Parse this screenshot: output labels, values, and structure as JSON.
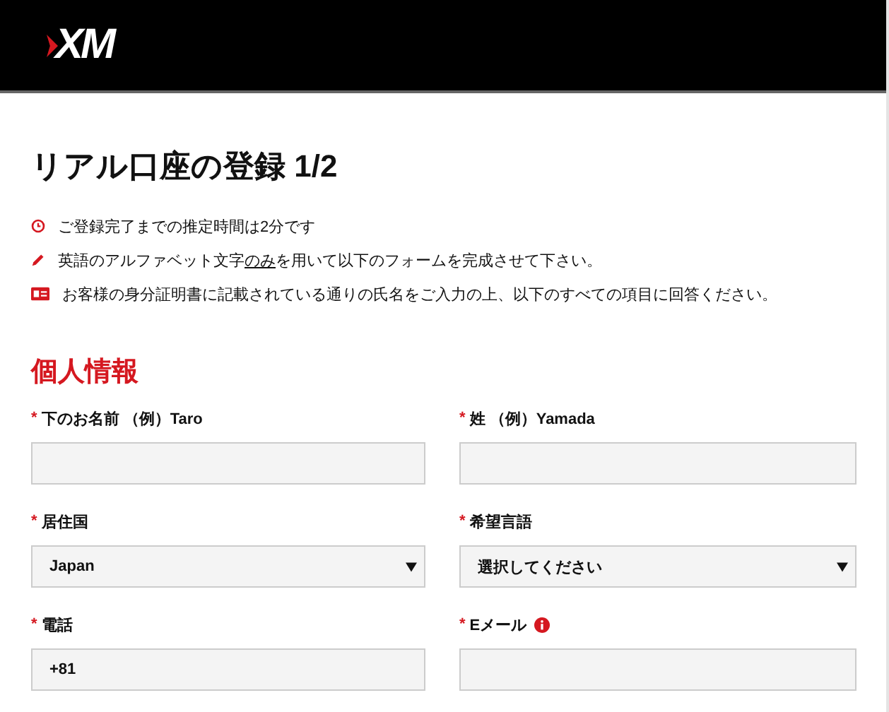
{
  "header": {
    "logo": "XM"
  },
  "title": "リアル口座の登録 1/2",
  "notes": [
    {
      "segments": [
        {
          "text": "ご登録完了までの推定時間は2分です",
          "underlined": false
        }
      ]
    },
    {
      "segments": [
        {
          "text": "英語のアルファベット文字",
          "underlined": false
        },
        {
          "text": "のみ",
          "underlined": true
        },
        {
          "text": "を用いて以下のフォームを完成させて下さい。",
          "underlined": false
        }
      ]
    },
    {
      "segments": [
        {
          "text": "お客様の身分証明書に記載されている通りの氏名をご入力の上、以下のすべての項目に回答ください。",
          "underlined": false
        }
      ]
    }
  ],
  "section": {
    "heading": "個人情報",
    "fields": [
      {
        "kind": "text",
        "marker": "*",
        "label": "下のお名前 （例）Taro",
        "has_info": false
      },
      {
        "kind": "text",
        "marker": "*",
        "label": "姓 （例）Yamada",
        "has_info": false
      },
      {
        "kind": "select",
        "marker": "*",
        "label": "居住国",
        "value": "Japan",
        "has_info": false
      },
      {
        "kind": "select",
        "marker": "*",
        "label": "希望言語",
        "value": "選択してください",
        "has_info": false
      },
      {
        "kind": "text",
        "marker": "*",
        "label": "電話",
        "value": "+81",
        "has_info": false
      },
      {
        "kind": "text",
        "marker": "*",
        "label": "Eメール",
        "has_info": true
      }
    ]
  }
}
